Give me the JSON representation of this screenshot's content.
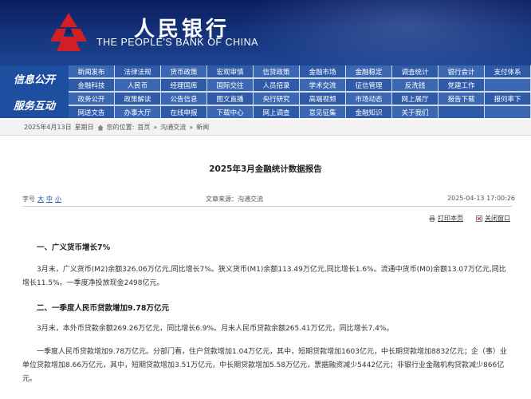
{
  "header": {
    "name_cn": "人民银行",
    "name_en": "THE PEOPLE'S BANK OF CHINA"
  },
  "nav": {
    "label1": "信息公开",
    "label2": "服务互动",
    "rows": [
      [
        "新闻发布",
        "法律法规",
        "货币政策",
        "宏观审慎",
        "信贷政策",
        "金融市场",
        "金融稳定",
        "调查统计",
        "银行会计",
        "支付体系"
      ],
      [
        "金融科技",
        "人民币",
        "经理国库",
        "国际交往",
        "人员招录",
        "学术交流",
        "征信管理",
        "反洗钱",
        "党建工作",
        ""
      ],
      [
        "政务公开",
        "政策解读",
        "公告信息",
        "图文直播",
        "央行研究",
        "高端视频",
        "市场动态",
        "网上展厅",
        "报告下载",
        "报何率下"
      ],
      [
        "网送文告",
        "办事大厅",
        "在线申报",
        "下载中心",
        "网上调查",
        "意见征集",
        "金融知识",
        "关于我们",
        "",
        ""
      ]
    ]
  },
  "breadcrumb": {
    "date": "2025年4月13日",
    "weekday": "星期日",
    "location_label": "您的位置:",
    "home": "首页",
    "sep1": "»",
    "level1": "沟通交流",
    "sep2": "»",
    "level2": "新闻"
  },
  "article": {
    "title": "2025年3月金融统计数据报告",
    "font_size_label": "字号",
    "font_sizes": [
      "大",
      "中",
      "小"
    ],
    "source": "文章来源：沟通交流",
    "time": "2025-04-13 17:00:26",
    "print": "打印本页",
    "close": "关闭窗口",
    "sections": [
      {
        "heading": "一、广义货币增长7%",
        "paragraphs": [
          "3月末，广义货币(M2)余额326.06万亿元,同比增长7%。狭义货币(M1)余额113.49万亿元,同比增长1.6%。流通中货币(M0)余额13.07万亿元,同比增长11.5%。一季度净投放现金2498亿元。"
        ]
      },
      {
        "heading": "二、一季度人民币贷款增加9.78万亿元",
        "paragraphs": [
          "3月末，本外币贷款余额269.26万亿元，同比增长6.9%。月末人民币贷款余额265.41万亿元，同比增长7.4%。",
          "一季度人民币贷款增加9.78万亿元。分部门看，住户贷款增加1.04万亿元，其中，短期贷款增加1603亿元，中长期贷款增加8832亿元；企（事）业单位贷款增加8.66万亿元，其中，短期贷款增加3.51万亿元，中长期贷款增加5.58万亿元，票据融资减少5442亿元；非银行业金融机构贷款减少866亿元。"
        ]
      }
    ]
  }
}
